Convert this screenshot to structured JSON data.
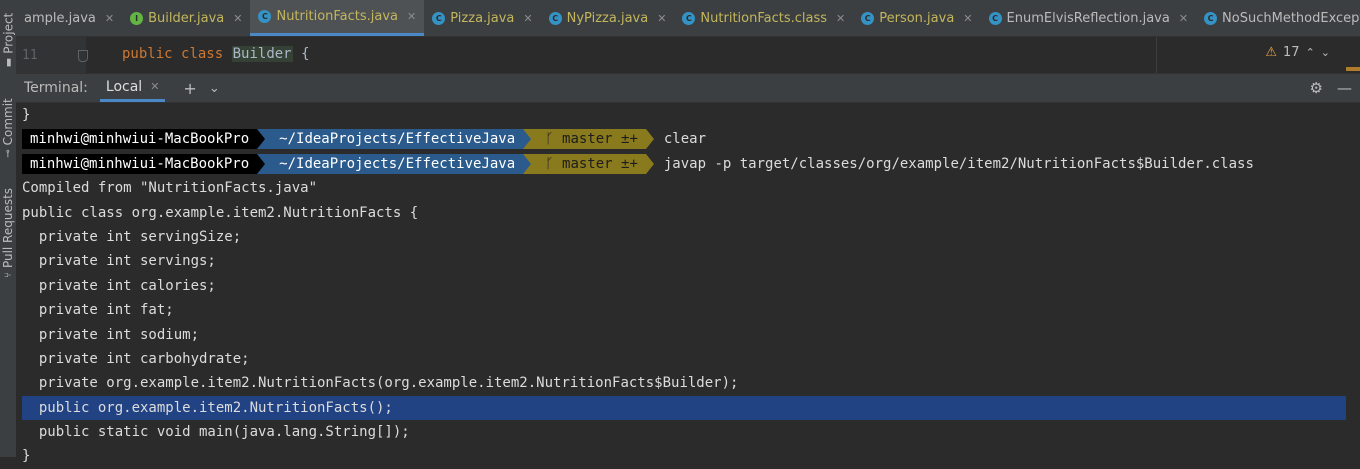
{
  "sidebar": {
    "items": [
      {
        "label": "Project",
        "icon": "folder-icon"
      },
      {
        "label": "Commit",
        "icon": "commit-icon"
      },
      {
        "label": "Pull Requests",
        "icon": "pull-request-icon"
      }
    ]
  },
  "tabs": [
    {
      "label": "ample.java",
      "icon": "none",
      "modified": false,
      "active": false
    },
    {
      "label": "Builder.java",
      "icon": "interface-icon",
      "modified": true,
      "active": false
    },
    {
      "label": "NutritionFacts.java",
      "icon": "class-icon",
      "modified": true,
      "active": true
    },
    {
      "label": "Pizza.java",
      "icon": "abstract-class-icon",
      "modified": true,
      "active": false
    },
    {
      "label": "NyPizza.java",
      "icon": "class-icon",
      "modified": true,
      "active": false
    },
    {
      "label": "NutritionFacts.class",
      "icon": "class-icon",
      "modified": true,
      "active": false
    },
    {
      "label": "Person.java",
      "icon": "class-icon",
      "modified": true,
      "active": false
    },
    {
      "label": "EnumElvisReflection.java",
      "icon": "class-icon",
      "modified": false,
      "active": false
    },
    {
      "label": "NoSuchMethodExcepti",
      "icon": "class-icon",
      "modified": false,
      "active": false
    }
  ],
  "editor": {
    "line_number": "11",
    "code_keyword1": "public",
    "code_keyword2": "class",
    "code_classname": "Builder",
    "code_brace": "{",
    "warning_count": "17"
  },
  "terminal": {
    "title": "Terminal:",
    "tab_label": "Local",
    "prompt": {
      "user": "minhwi@minhwiui-MacBookPro",
      "path": "~/IdeaProjects/EffectiveJava",
      "git": "master ±+"
    },
    "lines": [
      {
        "type": "text",
        "text": "}"
      },
      {
        "type": "prompt",
        "command": "clear"
      },
      {
        "type": "prompt",
        "command": "javap -p target/classes/org/example/item2/NutritionFacts$Builder.class"
      },
      {
        "type": "text",
        "text": "Compiled from \"NutritionFacts.java\""
      },
      {
        "type": "text",
        "text": "public class org.example.item2.NutritionFacts {"
      },
      {
        "type": "text",
        "text": "  private int servingSize;"
      },
      {
        "type": "text",
        "text": "  private int servings;"
      },
      {
        "type": "text",
        "text": "  private int calories;"
      },
      {
        "type": "text",
        "text": "  private int fat;"
      },
      {
        "type": "text",
        "text": "  private int sodium;"
      },
      {
        "type": "text",
        "text": "  private int carbohydrate;"
      },
      {
        "type": "text",
        "text": "  private org.example.item2.NutritionFacts(org.example.item2.NutritionFacts$Builder);"
      },
      {
        "type": "text",
        "text": "  public org.example.item2.NutritionFacts();",
        "selected": true
      },
      {
        "type": "text",
        "text": "  public static void main(java.lang.String[]);"
      },
      {
        "type": "text",
        "text": "}"
      }
    ]
  },
  "colors": {
    "accent": "#4a88c7",
    "selection": "#214283",
    "modified_tab_text": "#c3b65c",
    "keyword": "#cc7832"
  }
}
